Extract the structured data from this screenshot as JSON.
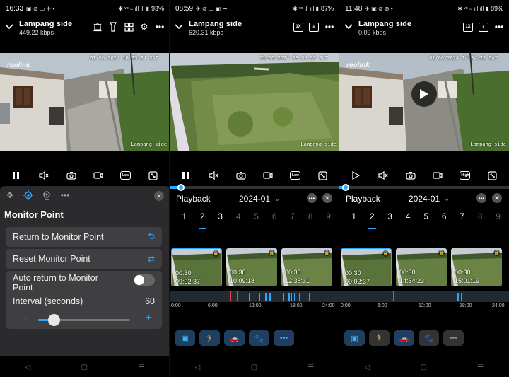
{
  "colors": {
    "accent": "#2aa7ff",
    "panel_bg": "#2b2b2d",
    "button_bg": "#3f3f42",
    "marker": "#e44444"
  },
  "screens": [
    {
      "status": {
        "time": "16:33",
        "battery": "93%",
        "left_icons": "▣ ⊚ ▭ ✈ •",
        "right_icons": "✱ ᵛᵒ ≈ ıll ıll ▮"
      },
      "camera": {
        "name": "Lampang side",
        "bitrate": "449.22 kbps"
      },
      "toolbar_icons": [
        "siren-icon",
        "flashlight-icon",
        "grid-icon",
        "gear-icon",
        "more-icon"
      ],
      "video": {
        "date": "01/06/2024 16:33:34 SAT",
        "osd_name": "Lampang side",
        "logo": "reolink"
      },
      "controls": [
        "pause-icon",
        "mute-icon",
        "snapshot-icon",
        "record-icon",
        "quality-icon",
        "fullscreen-icon"
      ],
      "quality_label": "Low",
      "ptz": {
        "title": "Monitor Point",
        "return_btn": "Return to Monitor Point",
        "reset_btn": "Reset Monitor Point",
        "auto_return": "Auto return to Monitor Point",
        "auto_return_on": false,
        "interval_label": "Interval (seconds)",
        "interval_value": "60",
        "interval_min": 10,
        "interval_max": 300,
        "tab_icons": [
          "ptz-icon",
          "monitor-point-icon",
          "preset-icon",
          "more-icon"
        ]
      }
    },
    {
      "status": {
        "time": "08:59",
        "battery": "87%",
        "left_icons": "✈ ⊚ ▭ ▣ ⊸",
        "right_icons": "✱ ᵛᵒ ıll ıll ▮"
      },
      "camera": {
        "name": "Lampang side",
        "bitrate": "620.31 kbps"
      },
      "speed_label": "1X",
      "video": {
        "date": "01/06/2024 08:59:33 SAT",
        "osd_name": "Lampang side"
      },
      "quality_label": "Low",
      "playback": {
        "title": "Playback",
        "month": "2024-01",
        "days": [
          "1",
          "2",
          "3",
          "4",
          "5",
          "6",
          "7",
          "8",
          "9"
        ],
        "selected_day": 1,
        "active_days": 3,
        "progress": 0.06,
        "thumbs": [
          {
            "duration": "00:30",
            "time": "09:02:37",
            "selected": true
          },
          {
            "duration": "00:30",
            "time": "10:09:18",
            "selected": false
          },
          {
            "duration": "00:30",
            "time": "12:38:31",
            "selected": false
          }
        ],
        "timeline_labels": [
          "0:00",
          "6:00",
          "12:00",
          "18:00",
          "24:00"
        ],
        "event_hours": [
          11.2,
          12.7,
          13.5,
          13.7,
          14.2,
          16.2,
          17.0,
          17.4,
          17.8,
          18.5,
          20.0
        ],
        "cursor_hour": 9.0,
        "actions": [
          {
            "icon": "all-events-icon",
            "glyph": "▣",
            "dim": false
          },
          {
            "icon": "person-icon",
            "glyph": "🏃",
            "dim": false
          },
          {
            "icon": "vehicle-icon",
            "glyph": "🚗",
            "dim": false
          },
          {
            "icon": "pet-icon",
            "glyph": "🐾",
            "dim": false
          },
          {
            "icon": "more-icon",
            "glyph": "•••",
            "dim": false
          }
        ]
      }
    },
    {
      "status": {
        "time": "11:48",
        "battery": "89%",
        "left_icons": "✈ ▣ ⊚ ⊚ •",
        "right_icons": "✱ ᵛᵒ ≈ ıll ıll ▮"
      },
      "camera": {
        "name": "Lampang side",
        "bitrate": "0.09 kbps"
      },
      "speed_label": "1X",
      "video": {
        "date": "01/06/2024 14:34:23 SAT",
        "osd_name": "Lampang side",
        "logo": "reolink"
      },
      "quality_label": "High",
      "playback": {
        "title": "Playback",
        "month": "2024-01",
        "days": [
          "1",
          "2",
          "3",
          "4",
          "5",
          "6",
          "7",
          "8",
          "9"
        ],
        "selected_day": 1,
        "active_days": 7,
        "progress": 0.03,
        "thumbs": [
          {
            "duration": "00:30",
            "time": "09:02:37",
            "selected": true
          },
          {
            "duration": "00:30",
            "time": "14:34:23",
            "selected": false
          },
          {
            "duration": "00:30",
            "time": "15:01:19",
            "selected": false
          }
        ],
        "timeline_labels": [
          "0:00",
          "6:00",
          "12:00",
          "18:00",
          "24:00"
        ],
        "event_hours": [
          16.0,
          16.4,
          16.9,
          17.4,
          17.8
        ],
        "cursor_hour": 7.0,
        "actions": [
          {
            "icon": "all-events-icon",
            "glyph": "▣",
            "dim": false
          },
          {
            "icon": "person-icon",
            "glyph": "🏃",
            "dim": true
          },
          {
            "icon": "vehicle-icon",
            "glyph": "🚗",
            "dim": false
          },
          {
            "icon": "pet-icon",
            "glyph": "🐾",
            "dim": true
          },
          {
            "icon": "more-icon",
            "glyph": "•••",
            "dim": true
          }
        ]
      }
    }
  ]
}
